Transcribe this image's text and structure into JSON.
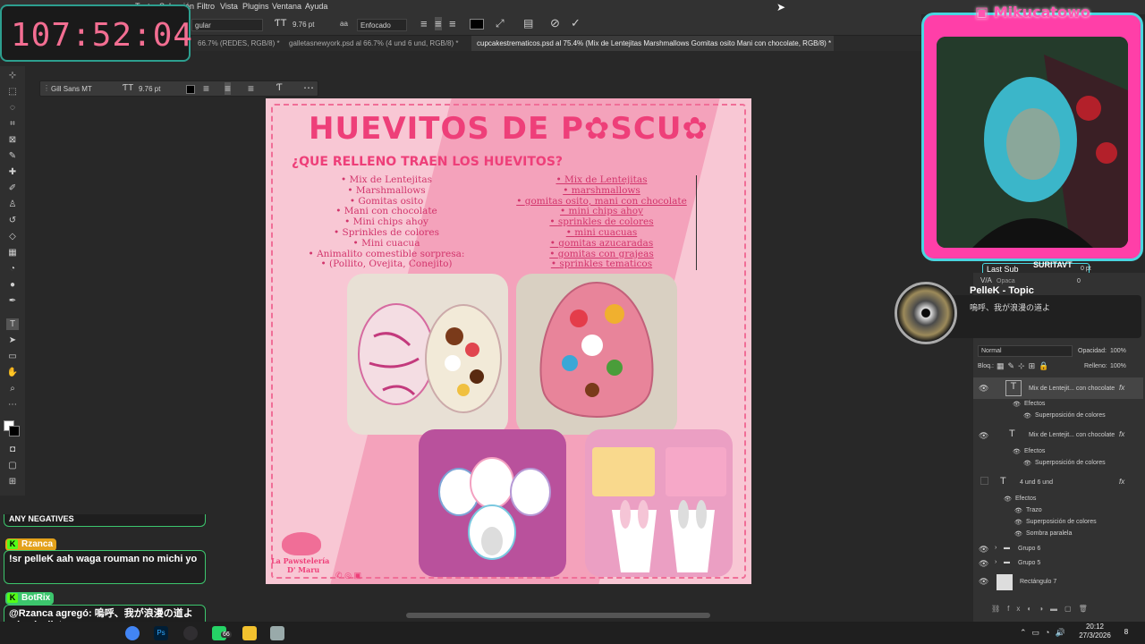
{
  "menu": {
    "items": [
      "Texto",
      "Selección",
      "Filtro",
      "Vista",
      "Plugins",
      "Ventana",
      "Ayuda"
    ]
  },
  "options_bar": {
    "font_style": "gular",
    "font_size": "9.76 pt",
    "antialias": "Enfocado",
    "aa_icon": "aa"
  },
  "doc_tabs": [
    {
      "label": "66.7% (REDES, RGB/8) *",
      "active": false
    },
    {
      "label": "galletasnewyork.psd al 66.7% (4 und  6 und, RGB/8) *",
      "active": false
    },
    {
      "label": "cupcakestrematicos.psd al 75.4% (Mix de Lentejitas Marshmallows Gomitas osito Mani con chocolate, RGB/8) *",
      "active": true
    }
  ],
  "float_bar": {
    "font": "Gill Sans MT",
    "size": "9.76 pt"
  },
  "poster": {
    "title": "HUEVITOS DE P✿SCU✿",
    "question": "¿QUE RELLENO TRAEN LOS HUEVITOS?",
    "left_list": [
      "Mix de Lentejitas",
      "Marshmallows",
      "Gomitas osito",
      "Mani con chocolate",
      "Mini chips ahoy",
      "Sprinkles de colores",
      "Mini cuacua",
      "Animalito comestible sorpresa:",
      "(Pollito, Ovejita, Conejito)"
    ],
    "right_list": [
      "Mix de Lentejitas",
      "marshmallows",
      "gomitas osito, mani con chocolate",
      "mini chips ahoy",
      "sprinkles de colores",
      "mini cuacuas",
      "gomitas azucaradas",
      "gomitas con grajeas",
      "sprinkles tematicos"
    ],
    "brand_line1": "La Pawstelería",
    "brand_line2": "D' Maru"
  },
  "timer": {
    "text": "107:52:04"
  },
  "stream": {
    "channel": "Mikucatowo",
    "sub_label": "Last Sub",
    "sub_name": "SURITAVT"
  },
  "music": {
    "title": "PelleK - Topic",
    "subtitle": "嗚呼、我が浪漫の道よ"
  },
  "layers_panel": {
    "blend_mode": "Normal",
    "opacity_label": "Opacidad:",
    "opacity_value": "100%",
    "lock_label": "Bloq.:",
    "fill_label": "Relleno:",
    "fill_value": "100%",
    "opacity_short": "Opaca",
    "va_label": "V/A",
    "pt_value": "0 pt",
    "zero_value": "0",
    "layers": [
      {
        "name": "Mix de Lentejit... con chocolate",
        "type": "T",
        "fx": true
      },
      {
        "name": "Efectos",
        "type": "sub"
      },
      {
        "name": "Superposición de colores",
        "type": "effect"
      },
      {
        "name": "Mix de Lentejit... con chocolate",
        "type": "T",
        "fx": true
      },
      {
        "name": "Efectos",
        "type": "sub"
      },
      {
        "name": "Superposición de colores",
        "type": "effect"
      },
      {
        "name": "4 und    6 und",
        "type": "T",
        "fx": true
      },
      {
        "name": "Efectos",
        "type": "sub"
      },
      {
        "name": "Trazo",
        "type": "effect"
      },
      {
        "name": "Superposición de colores",
        "type": "effect"
      },
      {
        "name": "Sombra paralela",
        "type": "effect"
      },
      {
        "name": "Grupo 6",
        "type": "group"
      },
      {
        "name": "Grupo 5",
        "type": "group"
      },
      {
        "name": "Rectángulo 7",
        "type": "shape"
      }
    ]
  },
  "chat": {
    "cut_text": "ANY NEGATIVES",
    "messages": [
      {
        "user": "Rzanca",
        "user_color": "#e3a11b",
        "text": "!sr pelleK aah waga rouman no michi yo"
      },
      {
        "user": "BotRix",
        "user_color": "#3cc66d",
        "text": "@Rzanca agregó: 嗚呼、我が浪漫の道よ a la playlist."
      }
    ]
  },
  "taskbar": {
    "time": "20:12",
    "date": "27/3/2026",
    "whatsapp_badge": "66",
    "notification_count": "8"
  }
}
